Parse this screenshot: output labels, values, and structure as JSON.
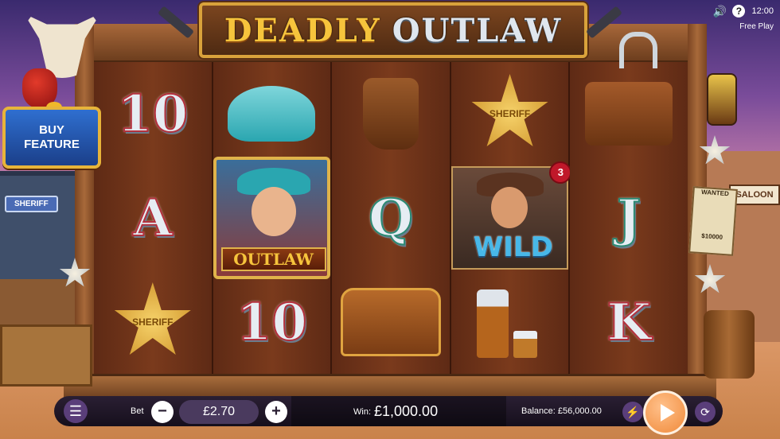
{
  "logo": {
    "word1": "DEADLY",
    "word2": "OUTLAW"
  },
  "buy_feature": {
    "line1": "BUY",
    "line2": "FEATURE"
  },
  "util": {
    "clock": "12:00",
    "free_play": "Free Play",
    "help": "?"
  },
  "town": {
    "sheriff_sign": "SHERIFF",
    "saloon_sign": "SALOON",
    "wanted": "WANTED",
    "reward": "$10000"
  },
  "reels": [
    {
      "r0": "10",
      "r1": "A",
      "r2": "sheriff-badge"
    },
    {
      "r0": "cowboy-hat",
      "r1": "outlaw",
      "r2": "10"
    },
    {
      "r0": "boots",
      "r1": "Q",
      "r2": "treasure-chest"
    },
    {
      "r0": "sheriff-badge",
      "r1": "wild",
      "r2": "whiskey"
    },
    {
      "r0": "gun-holster",
      "r1": "J",
      "r2": "K"
    }
  ],
  "symbols": {
    "outlaw_banner": "OUTLAW",
    "wild_text": "WILD",
    "wild_multiplier": "3",
    "sheriff_text": "SHERIFF"
  },
  "bottom_bar": {
    "bet_label": "Bet",
    "bet_value": "£2.70",
    "win_label": "Win:",
    "win_value": "£1,000.00",
    "balance_label": "Balance: £56,000.00"
  },
  "colors": {
    "accent": "#f08a3a",
    "bar": "#1f1628",
    "buy": "#2f6fd0"
  }
}
